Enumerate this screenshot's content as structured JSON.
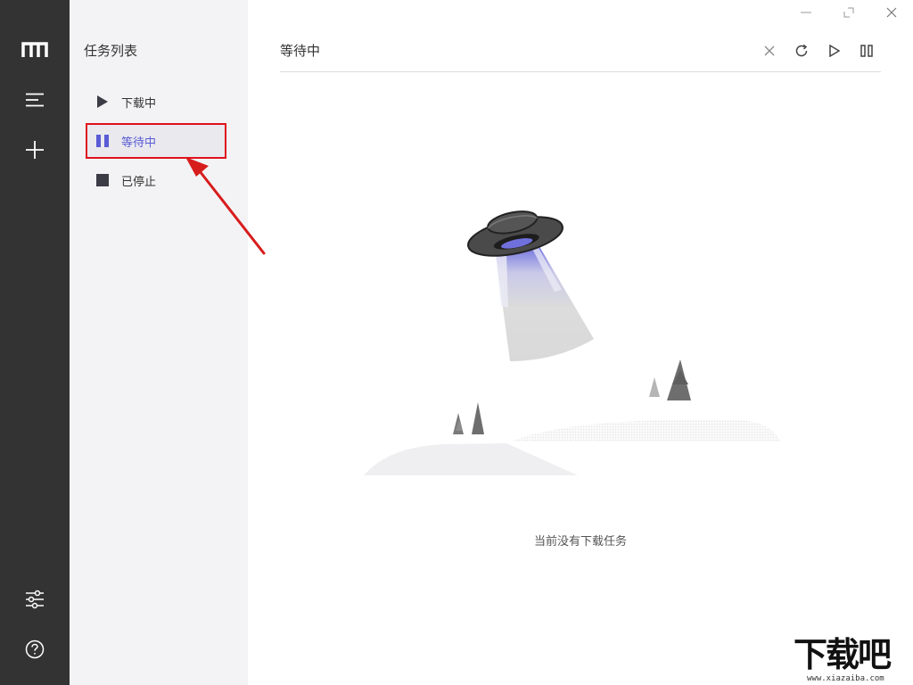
{
  "app": {
    "title": ""
  },
  "sidebar_list": {
    "title": "任务列表",
    "items": [
      {
        "label": "下载中",
        "icon": "play-icon",
        "active": false
      },
      {
        "label": "等待中",
        "icon": "pause-icon",
        "active": true
      },
      {
        "label": "已停止",
        "icon": "stop-icon",
        "active": false
      }
    ]
  },
  "main": {
    "title": "等待中",
    "empty_text": "当前没有下载任务"
  },
  "watermark": {
    "brand": "下载吧",
    "url": "www.xiazaiba.com"
  },
  "colors": {
    "rail": "#333333",
    "accent": "#5b5bd6",
    "highlight_box": "#e0101d",
    "list_bg": "#f3f3f5"
  }
}
